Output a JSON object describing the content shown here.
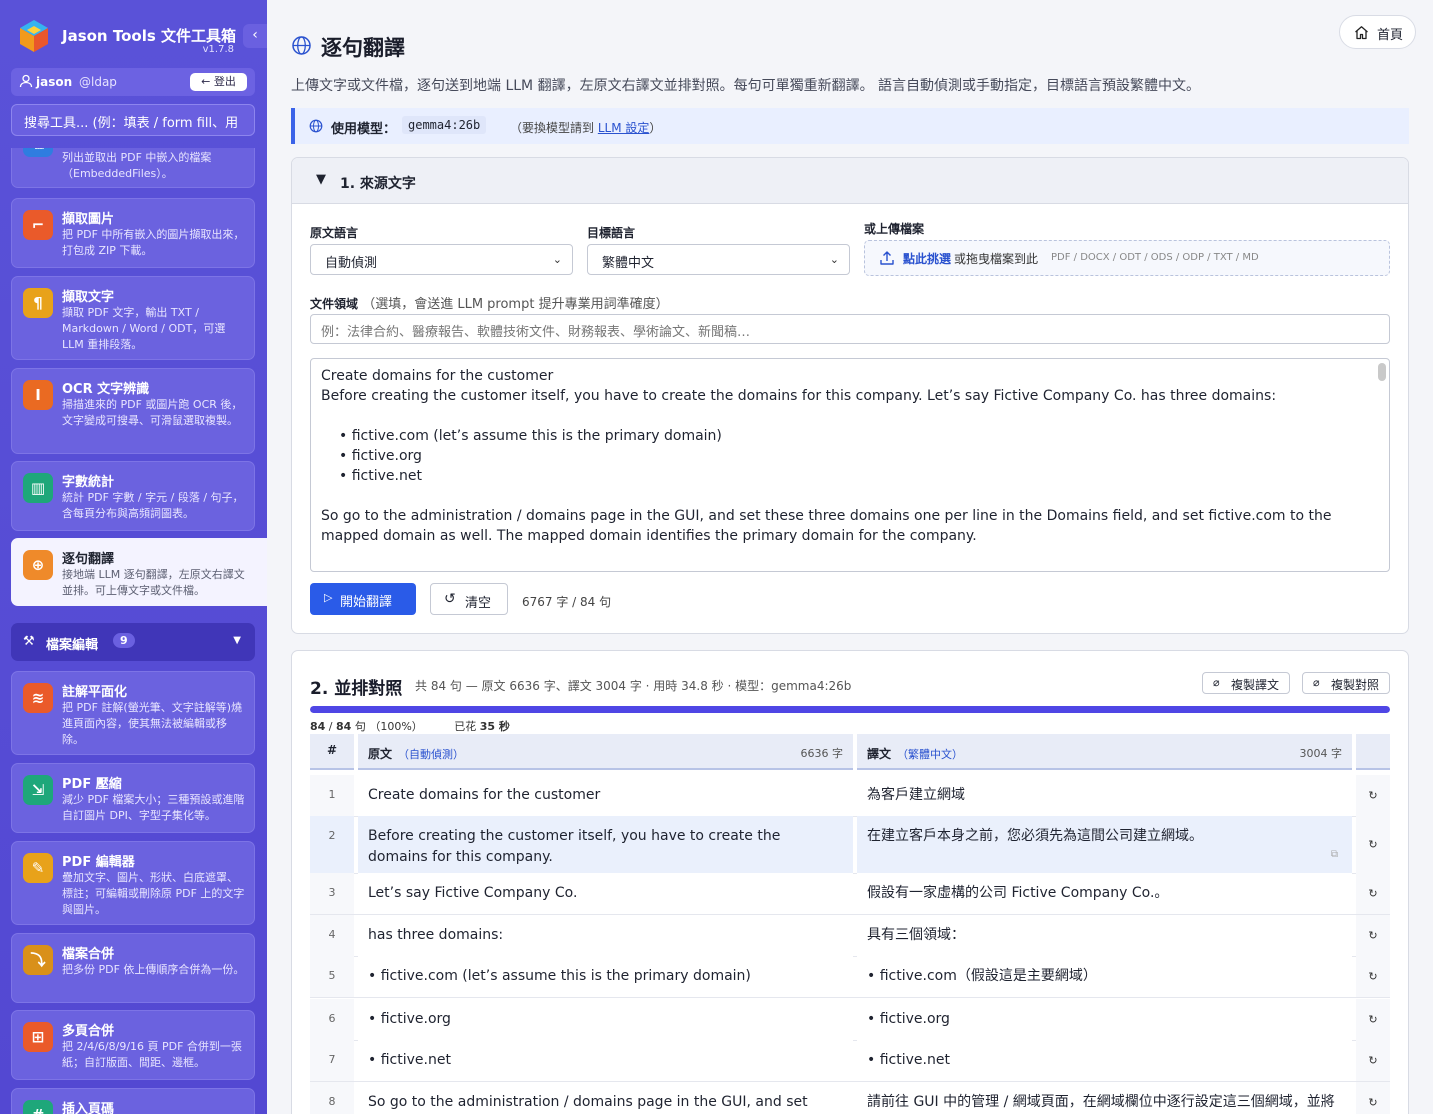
{
  "app": {
    "title": "Jason Tools 文件工具箱",
    "version": "v1.7.8",
    "collapse_glyph": "‹"
  },
  "user": {
    "name": "jason",
    "realm": "@ldap",
    "logout": "← 登出"
  },
  "search": {
    "placeholder": "搜尋工具... (例：填表 / form fill、用"
  },
  "tools": [
    {
      "name": "",
      "desc": "列出並取出 PDF 中嵌入的檔案（EmbeddedFiles）。",
      "icon": "embedded-files-icon",
      "color": "#2f7de0"
    },
    {
      "name": "擷取圖片",
      "desc": "把 PDF 中所有嵌入的圖片擷取出來，打包成 ZIP 下載。",
      "icon": "crop-icon",
      "color": "#ea5a2a"
    },
    {
      "name": "擷取文字",
      "desc": "擷取 PDF 文字，輸出 TXT / Markdown / Word / ODT，可選 LLM 重排段落。",
      "icon": "paragraph-icon",
      "color": "#e8a21a"
    },
    {
      "name": "OCR 文字辨識",
      "desc": "掃描進來的 PDF 或圖片跑 OCR 後，文字變成可搜尋、可滑鼠選取複製。",
      "icon": "text-cursor-icon",
      "color": "#ea6a22"
    },
    {
      "name": "字數統計",
      "desc": "統計 PDF 字數 / 字元 / 段落 / 句子，含每頁分布與高頻詞圖表。",
      "icon": "bar-chart-icon",
      "color": "#1ea77a"
    },
    {
      "name": "逐句翻譯",
      "desc": "接地端 LLM 逐句翻譯，左原文右譯文並排。可上傳文字或文件檔。",
      "icon": "globe-icon",
      "color": "#ef8a2a"
    }
  ],
  "category": {
    "label": "檔案編輯",
    "count": "9",
    "chevron": "▼"
  },
  "edit_tools": [
    {
      "name": "註解平面化",
      "desc": "把 PDF 註解(螢光筆、文字註解等)燒進頁面內容，使其無法被編輯或移除。",
      "icon": "layers-icon",
      "color": "#ea5a2a"
    },
    {
      "name": "PDF 壓縮",
      "desc": "減少 PDF 檔案大小；三種預設或進階自訂圖片 DPI、字型子集化等。",
      "icon": "compress-icon",
      "color": "#1ea77a"
    },
    {
      "name": "PDF 編輯器",
      "desc": "疊加文字、圖片、形狀、白底遮罩、標註；可編輯或刪除原 PDF 上的文字與圖片。",
      "icon": "pencil-icon",
      "color": "#e8a21a"
    },
    {
      "name": "檔案合併",
      "desc": "把多份 PDF 依上傳順序合併為一份。",
      "icon": "merge-icon",
      "color": "#d9901a"
    },
    {
      "name": "多頁合併",
      "desc": "把 2/4/6/8/9/16 頁 PDF 合併到一張紙；自訂版面、間距、邊框。",
      "icon": "grid-icon",
      "color": "#ea5a2a"
    },
    {
      "name": "插入頁碼",
      "desc": "",
      "icon": "hash-icon",
      "color": "#1ea77a"
    }
  ],
  "home": {
    "label": "首頁"
  },
  "page": {
    "title": "逐句翻譯",
    "description": "上傳文字或文件檔，逐句送到地端 LLM 翻譯，左原文右譯文並排對照。每句可單獨重新翻譯。 語言自動偵測或手動指定，目標語言預設繁體中文。"
  },
  "model": {
    "label": "使用模型：",
    "name": "gemma4:26b",
    "hint_prefix": "（要換模型請到 ",
    "hint_link": "LLM 設定",
    "hint_suffix": "）"
  },
  "source_section": {
    "header": "1. 來源文字",
    "toggle": "▼",
    "src_lang_label": "原文語言",
    "src_lang_value": "自動偵測",
    "tgt_lang_label": "目標語言",
    "tgt_lang_value": "繁體中文",
    "upload_label": "或上傳檔案",
    "upload_link": "點此挑選",
    "upload_text": "或拖曳檔案到此",
    "upload_formats": "PDF / DOCX / ODT / ODS / ODP / TXT / MD",
    "domain_label": "文件領域",
    "domain_hint": "（選填，會送進 LLM prompt 提升專業用詞準確度）",
    "domain_placeholder": "例：法律合約、醫療報告、軟體技術文件、財務報表、學術論文、新聞稿…",
    "text_lines": [
      "Create domains for the customer",
      "Before creating the customer itself, you have to create the domains for this company. Let’s say Fictive Company Co. has three domains:",
      "",
      "• fictive.com (let’s assume this is the primary domain)",
      "• fictive.org",
      "• fictive.net",
      "",
      "So go to the administration / domains page in the GUI, and set these three domains one per line in the Domains field, and set fictive.com to the mapped domain as well. The mapped domain identifies the primary domain for the company."
    ],
    "start_button": "開始翻譯",
    "clear_button": "清空",
    "count": "6767 字 / 84 句"
  },
  "result": {
    "title": "2. 並排對照",
    "stats": "共 84 句 — 原文 6636 字、譯文 3004 字 · 用時 34.8 秒 · 模型：gemma4:26b",
    "copy_translation": "複製譯文",
    "copy_bilingual": "複製對照",
    "progress_done": "84",
    "progress_total": "84",
    "progress_unit": "句",
    "progress_pct": "（100%）",
    "progress_fraction": 1.0,
    "elapsed_label": "已花",
    "elapsed": "35 秒",
    "col_num": "#",
    "col_src": "原文",
    "col_src_lang": "（自動偵測）",
    "col_src_count": "6636 字",
    "col_dst": "譯文",
    "col_dst_lang": "（繁體中文）",
    "col_dst_count": "3004 字",
    "rows": [
      {
        "n": "1",
        "src": "Create domains for the customer",
        "dst": "為客戶建立網域"
      },
      {
        "n": "2",
        "src": "Before creating the customer itself, you have to create the domains for this company.",
        "dst": "在建立客戶本身之前，您必須先為這間公司建立網域。"
      },
      {
        "n": "3",
        "src": "Let’s say Fictive Company Co.",
        "dst": "假設有一家虛構的公司 Fictive Company Co.。"
      },
      {
        "n": "4",
        "src": "has three domains:",
        "dst": "具有三個領域："
      },
      {
        "n": "5",
        "src": "• fictive.com (let’s assume this is the primary domain)",
        "dst": "• fictive.com（假設這是主要網域）"
      },
      {
        "n": "6",
        "src": "• fictive.org",
        "dst": "• fictive.org"
      },
      {
        "n": "7",
        "src": "• fictive.net",
        "dst": "• fictive.net"
      },
      {
        "n": "8",
        "src": "So go to the administration / domains page in the GUI, and set these",
        "dst": "請前往 GUI 中的管理 / 網域頁面，在網域欄位中逐行設定這三個網域，並將"
      }
    ],
    "retranslate_glyph": "↻"
  }
}
